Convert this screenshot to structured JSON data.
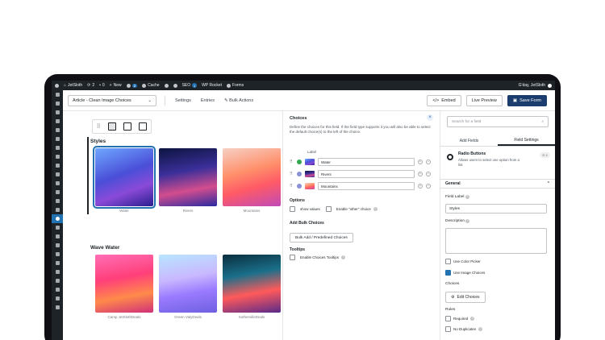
{
  "adminbar": {
    "site": "JetSloth",
    "updates": "2",
    "comments": "0",
    "new": "New",
    "badge_num": "2",
    "cache": "Cache",
    "seo": "SEO",
    "seo_count": "1",
    "rocket": "WP Rocket",
    "forms": "Forms",
    "greeting": "G'day, JetSloth"
  },
  "toolbar": {
    "form_name": "Article - Clean Image Choices",
    "settings": "Settings",
    "entries": "Entries",
    "bulk_actions": "Bulk Actions",
    "embed": "Embed",
    "embed_icon": "</>",
    "preview": "Live Preview",
    "save": "Save Form"
  },
  "canvas": {
    "styles_label": "Styles",
    "styles_choices": [
      "Water",
      "Rivers",
      "Mountains"
    ],
    "wave_label": "Wave Water",
    "wave_choices": [
      "Camp JetSlothDeals",
      "Green ValyDeals",
      "SothervilleDeals"
    ]
  },
  "choices_panel": {
    "title": "Choices",
    "description": "Define the choices for this field. If the field type supports it you will also be able to select the default choice(s) to the left of the choice.",
    "label_header": "Label",
    "items": [
      "Water",
      "Rivers",
      "Mountains"
    ],
    "options_title": "Options",
    "show_values": "show values",
    "enable_other": "Enable \"other\" choice",
    "bulk_title": "Add Bulk Choices",
    "bulk_button": "Bulk Add / Predefined Choices",
    "tooltips_title": "Tooltips",
    "enable_tooltips": "Enable Choices Tooltips"
  },
  "right_sidebar": {
    "search_placeholder": "Search for a field",
    "tab_add": "Add Fields",
    "tab_settings": "Field Settings",
    "field_type": "Radio Buttons",
    "field_desc": "Allows users to select one option from a list.",
    "field_id": "1",
    "general": "General",
    "field_label": "Field Label",
    "field_label_value": "Styles",
    "description": "Description",
    "use_color_picker": "Use Color Picker",
    "use_image_choices": "Use Image Choices",
    "choices": "Choices",
    "edit_choices": "Edit Choices",
    "rules": "Rules",
    "required": "Required",
    "no_duplicates": "No Duplicates"
  }
}
